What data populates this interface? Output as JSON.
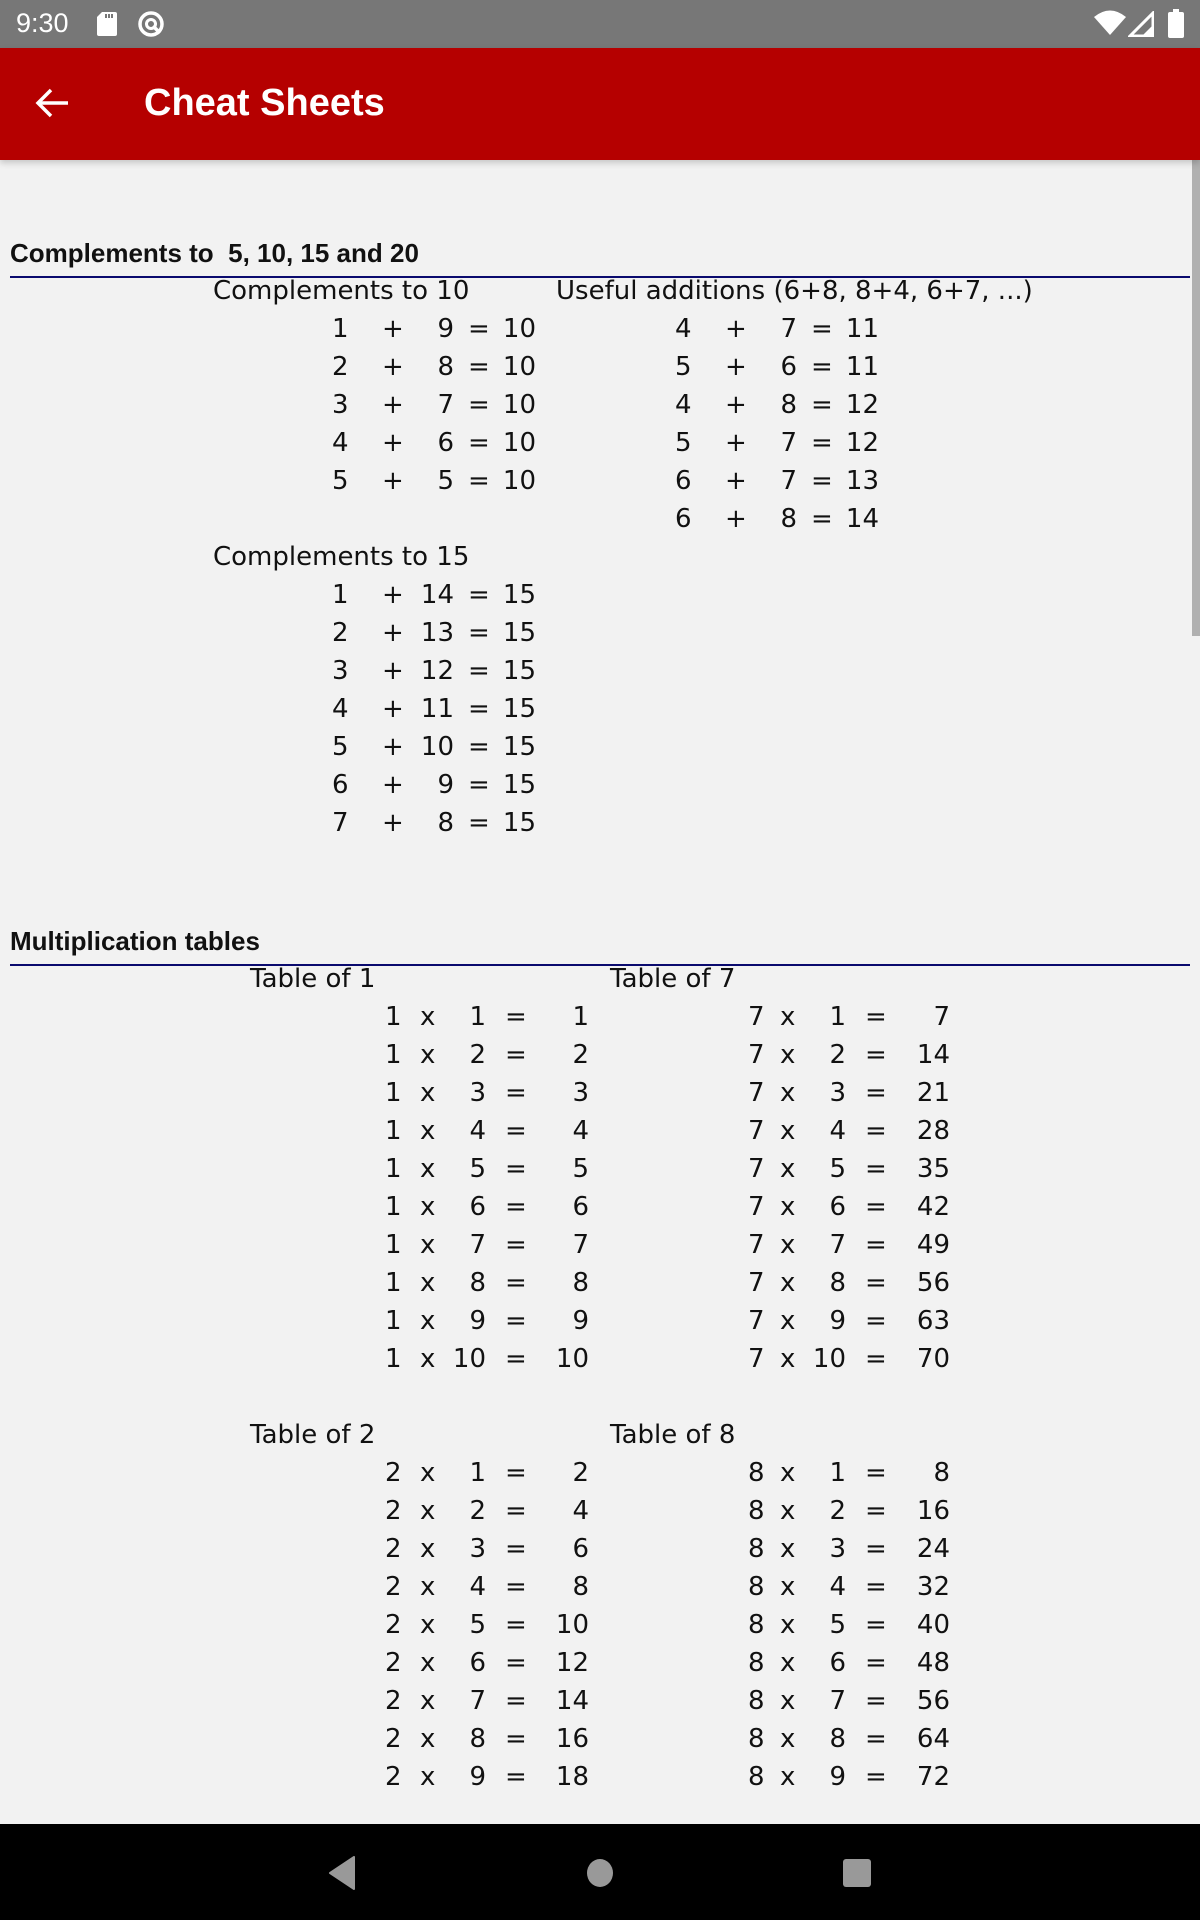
{
  "status_bar": {
    "time": "9:30",
    "icons": [
      "sd-card-icon",
      "q-icon",
      "wifi-icon",
      "cell-signal-icon",
      "battery-icon"
    ]
  },
  "app_bar": {
    "back_icon": "arrow-left-icon",
    "title": "Cheat Sheets",
    "color": "#b50000"
  },
  "sections": [
    {
      "title": "Complements to  5, 10, 15 and 20",
      "rule_color": "#0a0a6e",
      "groups": [
        {
          "title": "Complements to 10",
          "operator": "+",
          "rows": [
            {
              "a": "1",
              "b": "9",
              "r": "10"
            },
            {
              "a": "2",
              "b": "8",
              "r": "10"
            },
            {
              "a": "3",
              "b": "7",
              "r": "10"
            },
            {
              "a": "4",
              "b": "6",
              "r": "10"
            },
            {
              "a": "5",
              "b": "5",
              "r": "10"
            }
          ]
        },
        {
          "title": "Useful additions (6+8, 8+4, 6+7, ...)",
          "operator": "+",
          "rows": [
            {
              "a": "4",
              "b": "7",
              "r": "11"
            },
            {
              "a": "5",
              "b": "6",
              "r": "11"
            },
            {
              "a": "4",
              "b": "8",
              "r": "12"
            },
            {
              "a": "5",
              "b": "7",
              "r": "12"
            },
            {
              "a": "6",
              "b": "7",
              "r": "13"
            },
            {
              "a": "6",
              "b": "8",
              "r": "14"
            }
          ]
        },
        {
          "title": "Complements to 15",
          "operator": "+",
          "rows": [
            {
              "a": "1",
              "b": "14",
              "r": "15"
            },
            {
              "a": "2",
              "b": "13",
              "r": "15"
            },
            {
              "a": "3",
              "b": "12",
              "r": "15"
            },
            {
              "a": "4",
              "b": "11",
              "r": "15"
            },
            {
              "a": "5",
              "b": "10",
              "r": "15"
            },
            {
              "a": "6",
              "b": "9",
              "r": "15"
            },
            {
              "a": "7",
              "b": "8",
              "r": "15"
            }
          ]
        }
      ]
    },
    {
      "title": "Multiplication tables",
      "rule_color": "#0a0a6e",
      "groups": [
        {
          "title": "Table of 1",
          "operator": "x",
          "rows": [
            {
              "a": "1",
              "b": "1",
              "r": "1"
            },
            {
              "a": "1",
              "b": "2",
              "r": "2"
            },
            {
              "a": "1",
              "b": "3",
              "r": "3"
            },
            {
              "a": "1",
              "b": "4",
              "r": "4"
            },
            {
              "a": "1",
              "b": "5",
              "r": "5"
            },
            {
              "a": "1",
              "b": "6",
              "r": "6"
            },
            {
              "a": "1",
              "b": "7",
              "r": "7"
            },
            {
              "a": "1",
              "b": "8",
              "r": "8"
            },
            {
              "a": "1",
              "b": "9",
              "r": "9"
            },
            {
              "a": "1",
              "b": "10",
              "r": "10"
            }
          ]
        },
        {
          "title": "Table of 7",
          "operator": "x",
          "rows": [
            {
              "a": "7",
              "b": "1",
              "r": "7"
            },
            {
              "a": "7",
              "b": "2",
              "r": "14"
            },
            {
              "a": "7",
              "b": "3",
              "r": "21"
            },
            {
              "a": "7",
              "b": "4",
              "r": "28"
            },
            {
              "a": "7",
              "b": "5",
              "r": "35"
            },
            {
              "a": "7",
              "b": "6",
              "r": "42"
            },
            {
              "a": "7",
              "b": "7",
              "r": "49"
            },
            {
              "a": "7",
              "b": "8",
              "r": "56"
            },
            {
              "a": "7",
              "b": "9",
              "r": "63"
            },
            {
              "a": "7",
              "b": "10",
              "r": "70"
            }
          ]
        },
        {
          "title": "Table of 2",
          "operator": "x",
          "rows": [
            {
              "a": "2",
              "b": "1",
              "r": "2"
            },
            {
              "a": "2",
              "b": "2",
              "r": "4"
            },
            {
              "a": "2",
              "b": "3",
              "r": "6"
            },
            {
              "a": "2",
              "b": "4",
              "r": "8"
            },
            {
              "a": "2",
              "b": "5",
              "r": "10"
            },
            {
              "a": "2",
              "b": "6",
              "r": "12"
            },
            {
              "a": "2",
              "b": "7",
              "r": "14"
            },
            {
              "a": "2",
              "b": "8",
              "r": "16"
            },
            {
              "a": "2",
              "b": "9",
              "r": "18"
            }
          ]
        },
        {
          "title": "Table of 8",
          "operator": "x",
          "rows": [
            {
              "a": "8",
              "b": "1",
              "r": "8"
            },
            {
              "a": "8",
              "b": "2",
              "r": "16"
            },
            {
              "a": "8",
              "b": "3",
              "r": "24"
            },
            {
              "a": "8",
              "b": "4",
              "r": "32"
            },
            {
              "a": "8",
              "b": "5",
              "r": "40"
            },
            {
              "a": "8",
              "b": "6",
              "r": "48"
            },
            {
              "a": "8",
              "b": "7",
              "r": "56"
            },
            {
              "a": "8",
              "b": "8",
              "r": "64"
            },
            {
              "a": "8",
              "b": "9",
              "r": "72"
            }
          ]
        }
      ]
    }
  ],
  "equals_sign": "=",
  "nav_bar": {
    "icons": [
      "nav-back-icon",
      "nav-home-icon",
      "nav-recents-icon"
    ]
  }
}
